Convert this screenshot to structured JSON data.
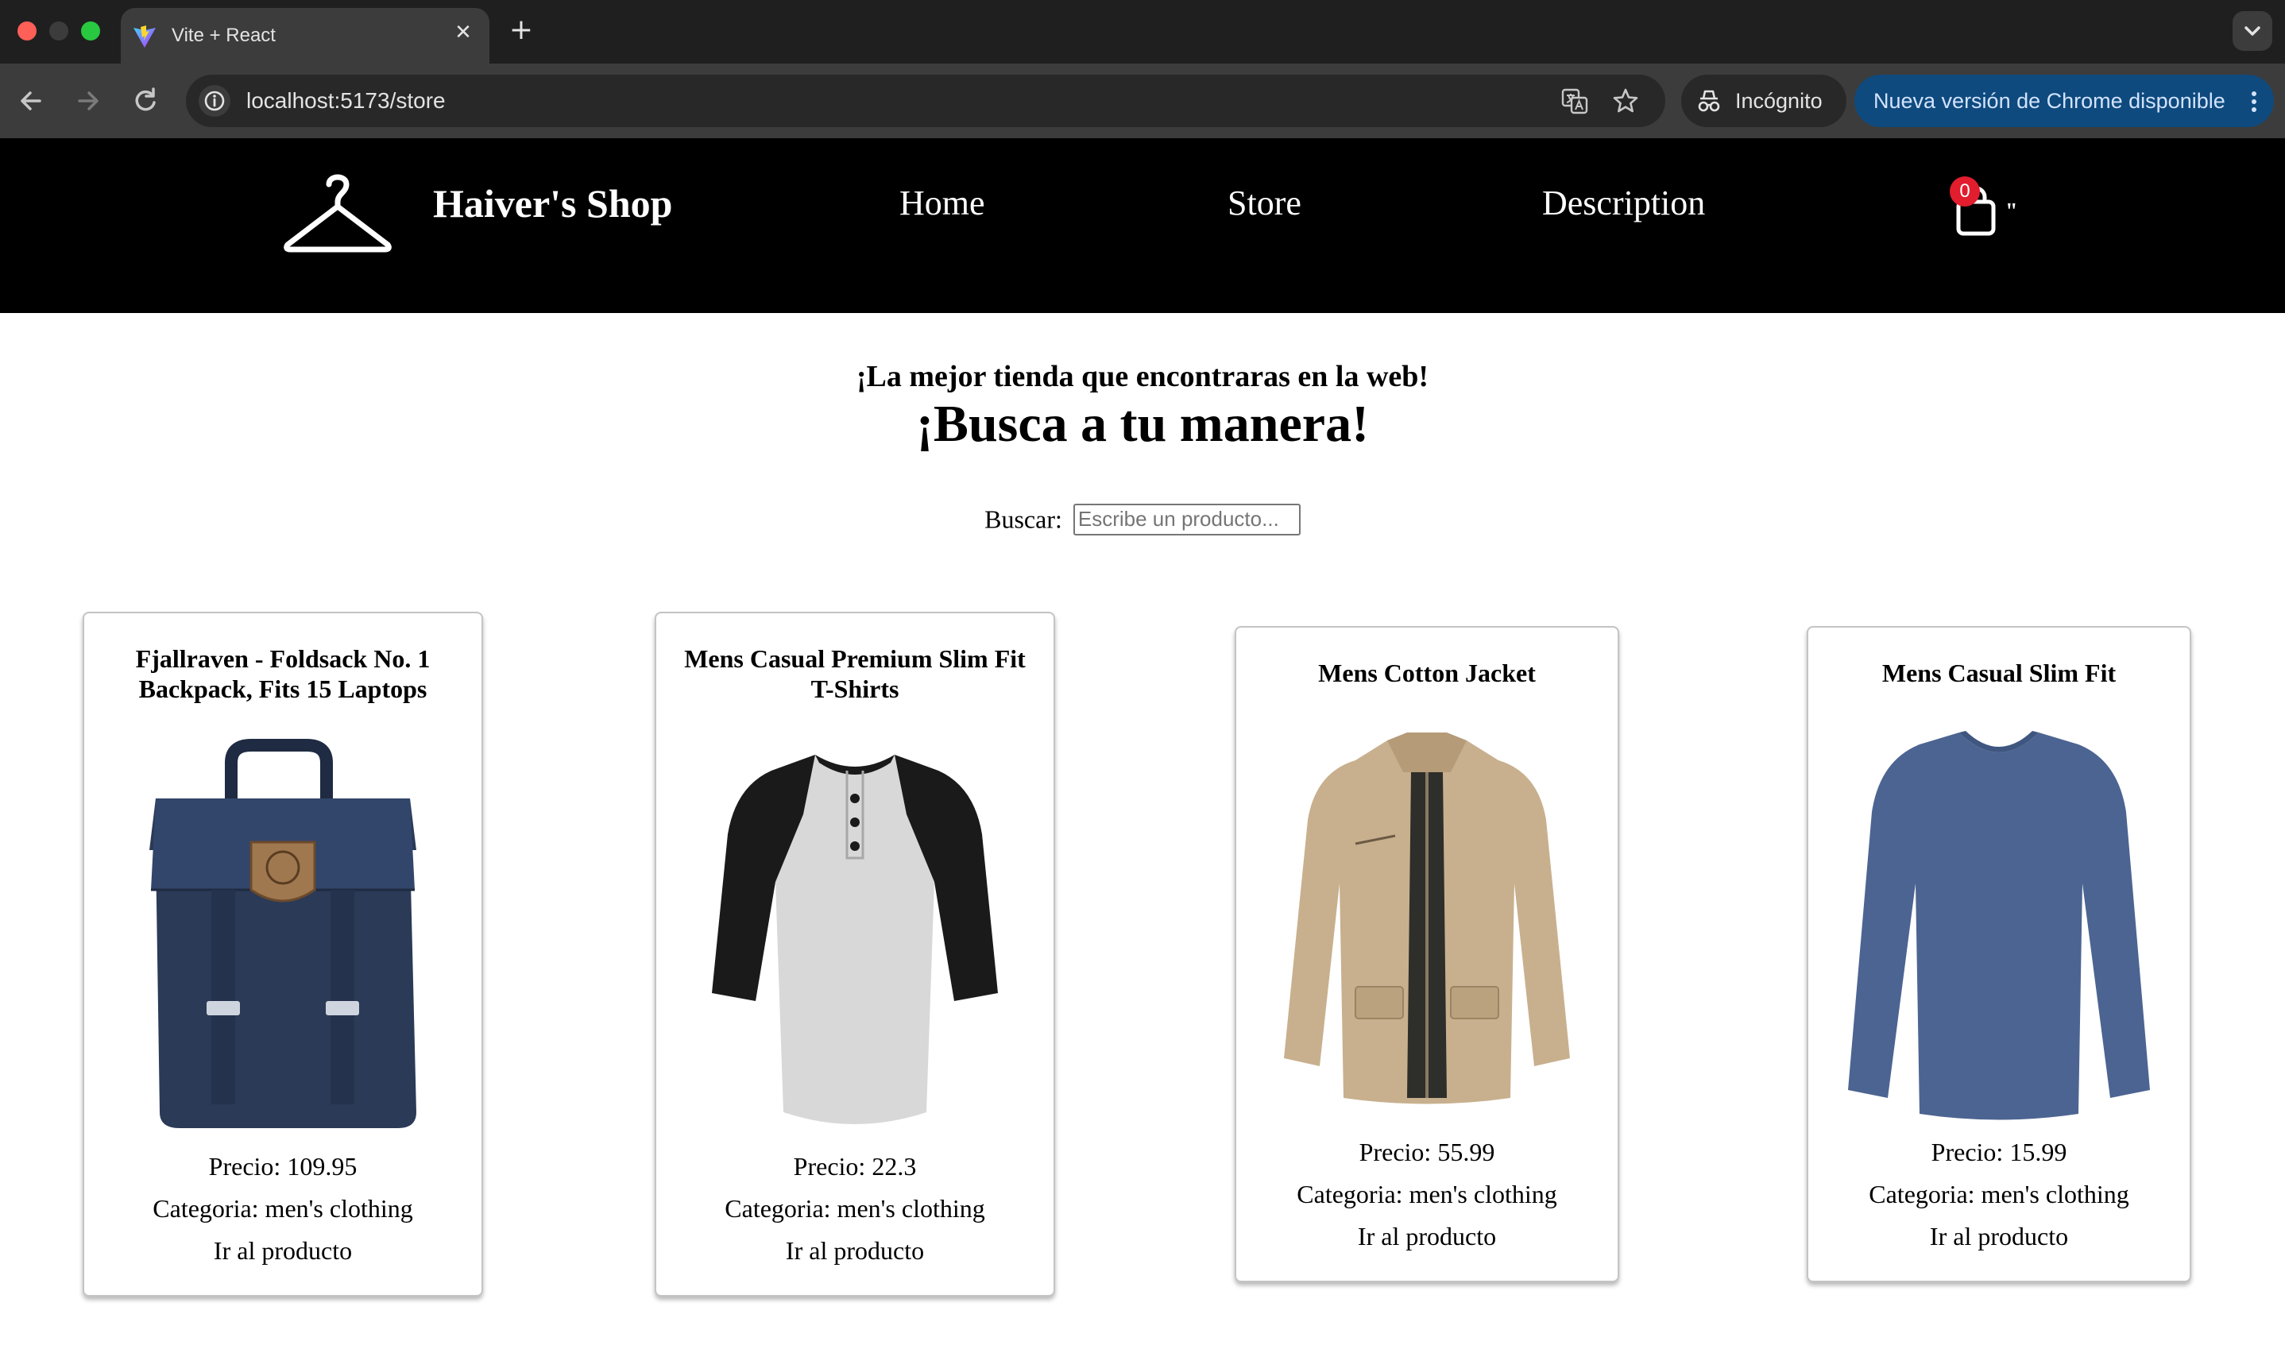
{
  "browser": {
    "tab_title": "Vite + React",
    "tab_close_glyph": "✕",
    "new_tab_glyph": "+",
    "url": "localhost:5173/store",
    "incognito_label": "Incógnito",
    "update_label": "Nueva versión de Chrome disponible"
  },
  "header": {
    "brand": "Haiver's Shop",
    "nav": [
      "Home",
      "Store",
      "Description"
    ],
    "cart_count": "0",
    "cart_trailing_text": "\""
  },
  "hero": {
    "subtitle": "¡La mejor tienda que encontraras en la web!",
    "title": "¡Busca a tu manera!"
  },
  "search": {
    "label": "Buscar:",
    "placeholder": "Escribe un producto...",
    "value": ""
  },
  "products": [
    {
      "title": "Fjallraven - Foldsack No. 1 Backpack, Fits 15 Laptops",
      "price": "Precio: 109.95",
      "category": "Categoria: men's clothing",
      "link": "Ir al producto",
      "image_icon": "backpack-image"
    },
    {
      "title": "Mens Casual Premium Slim Fit T-Shirts",
      "price": "Precio: 22.3",
      "category": "Categoria: men's clothing",
      "link": "Ir al producto",
      "image_icon": "raglan-shirt-image"
    },
    {
      "title": "Mens Cotton Jacket",
      "price": "Precio: 55.99",
      "category": "Categoria: men's clothing",
      "link": "Ir al producto",
      "image_icon": "jacket-image"
    },
    {
      "title": "Mens Casual Slim Fit",
      "price": "Precio: 15.99",
      "category": "Categoria: men's clothing",
      "link": "Ir al producto",
      "image_icon": "long-sleeve-shirt-image"
    }
  ],
  "colors": {
    "header_bg": "#000000",
    "cart_badge": "#e11d2e",
    "update_pill": "#0e4a7e",
    "backpack": "#2a3a57",
    "jacket": "#c8b08e",
    "long_sleeve": "#4c6491"
  }
}
